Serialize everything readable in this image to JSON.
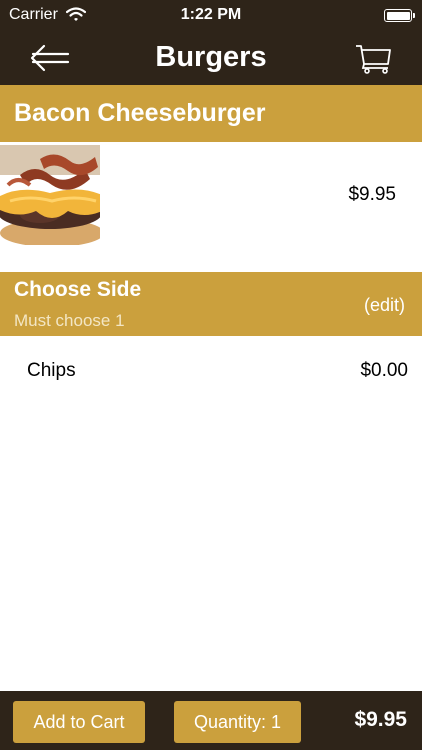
{
  "status_bar": {
    "carrier": "Carrier",
    "time": "1:22 PM",
    "wifi_icon": "wifi-icon",
    "battery_icon": "battery-icon"
  },
  "nav": {
    "title": "Burgers",
    "back_icon": "back-arrow-icon",
    "cart_icon": "cart-icon"
  },
  "item": {
    "name": "Bacon Cheeseburger",
    "price": "$9.95",
    "image": "bacon-cheeseburger-photo"
  },
  "side_section": {
    "title": "Choose Side",
    "subtitle": "Must choose 1",
    "edit_label": "(edit)",
    "options": [
      {
        "label": "Chips",
        "price": "$0.00"
      }
    ]
  },
  "bottom_bar": {
    "add_to_cart_label": "Add to Cart",
    "quantity_label": "Quantity: 1",
    "total": "$9.95"
  },
  "colors": {
    "bar_dark": "#2e2419",
    "accent_gold": "#cba03d",
    "text_white": "#ffffff"
  }
}
